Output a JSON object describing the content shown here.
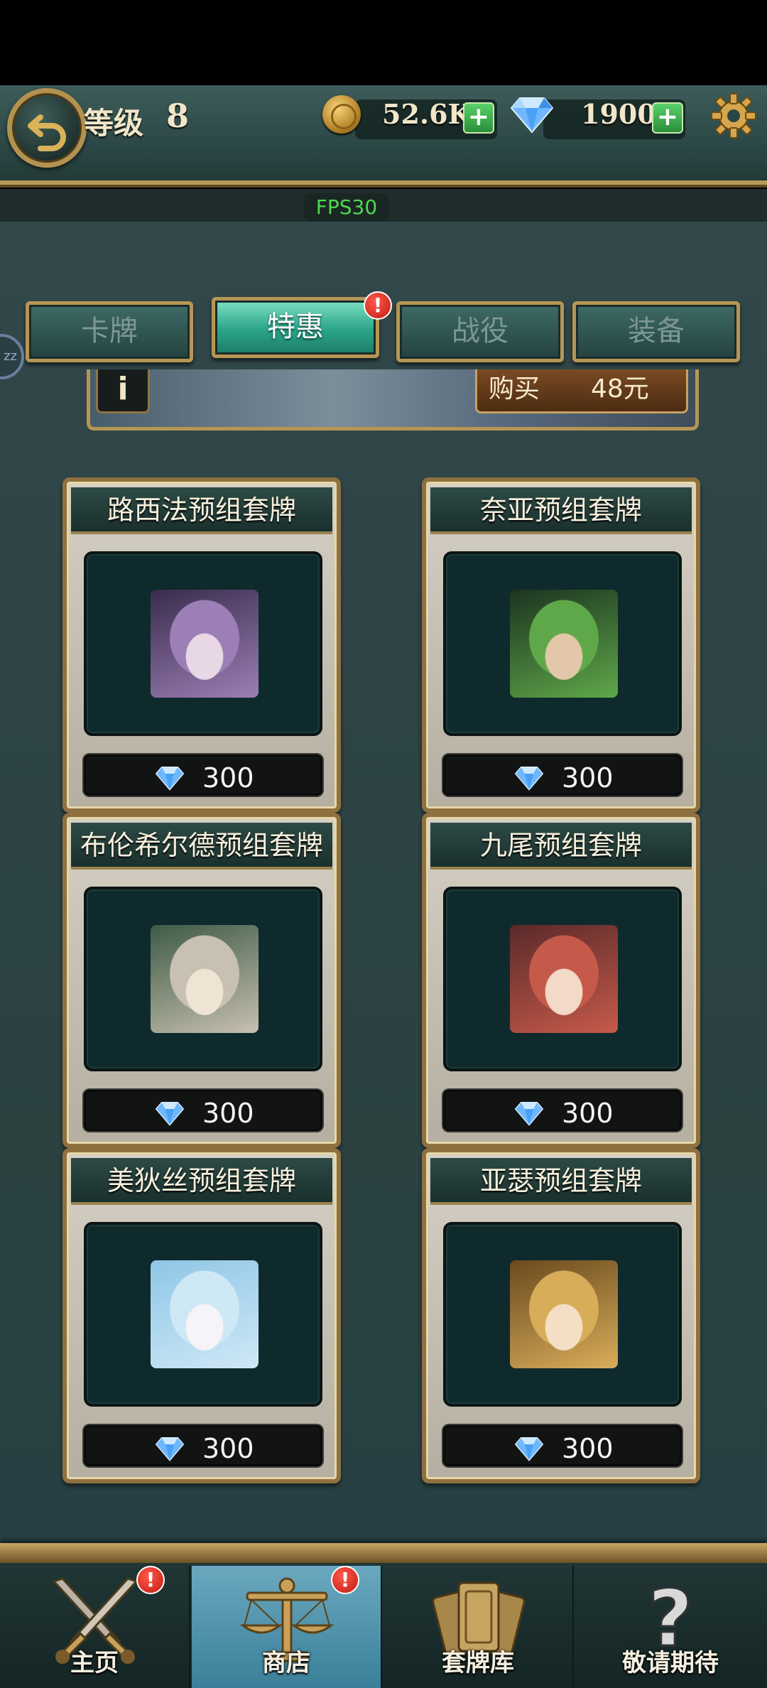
{
  "header": {
    "level_label": "等级",
    "level_value": "8",
    "gold_amount": "52.6K",
    "gem_amount": "1900",
    "plus_symbol": "+"
  },
  "fps": "FPS30",
  "tabs": [
    {
      "label": "卡牌",
      "active": false
    },
    {
      "label": "特惠",
      "active": true
    },
    {
      "label": "战役",
      "active": false
    },
    {
      "label": "装备",
      "active": false
    }
  ],
  "tab_badge": "!",
  "side_handle": "zz",
  "banner": {
    "info_label": "i",
    "buy_label": "购买",
    "buy_price": "48元"
  },
  "packs": [
    {
      "title": "路西法预组套牌",
      "price": "300",
      "portrait_colors": [
        "#3a2c4c",
        "#9b7fb6",
        "#e8d8e6"
      ]
    },
    {
      "title": "奈亚预组套牌",
      "price": "300",
      "portrait_colors": [
        "#1c3320",
        "#5fa84a",
        "#e2c7a8"
      ]
    },
    {
      "title": "布伦希尔德预组套牌",
      "price": "300",
      "portrait_colors": [
        "#3d5b46",
        "#c8c0b0",
        "#efe4d4"
      ]
    },
    {
      "title": "九尾预组套牌",
      "price": "300",
      "portrait_colors": [
        "#5a2a2a",
        "#c65a4a",
        "#f2d9c8"
      ]
    },
    {
      "title": "美狄丝预组套牌",
      "price": "300",
      "portrait_colors": [
        "#8fc6e6",
        "#cfe8f6",
        "#f6f4f8"
      ]
    },
    {
      "title": "亚瑟预组套牌",
      "price": "300",
      "portrait_colors": [
        "#6b4a1e",
        "#d8ad5a",
        "#f3e0c4"
      ]
    }
  ],
  "bottom_nav": [
    {
      "label": "主页",
      "icon": "crossed-swords-icon",
      "active": false,
      "badge": "!"
    },
    {
      "label": "商店",
      "icon": "scales-icon",
      "active": true,
      "badge": "!"
    },
    {
      "label": "套牌库",
      "icon": "card-deck-icon",
      "active": false,
      "badge": ""
    },
    {
      "label": "敬请期待",
      "icon": "question-mark-icon",
      "active": false,
      "badge": ""
    }
  ],
  "colors": {
    "accent_gold": "#b59655",
    "active_tab": "#2aa48a",
    "badge_red": "#c11a14",
    "fps_green": "#4ed94e"
  }
}
